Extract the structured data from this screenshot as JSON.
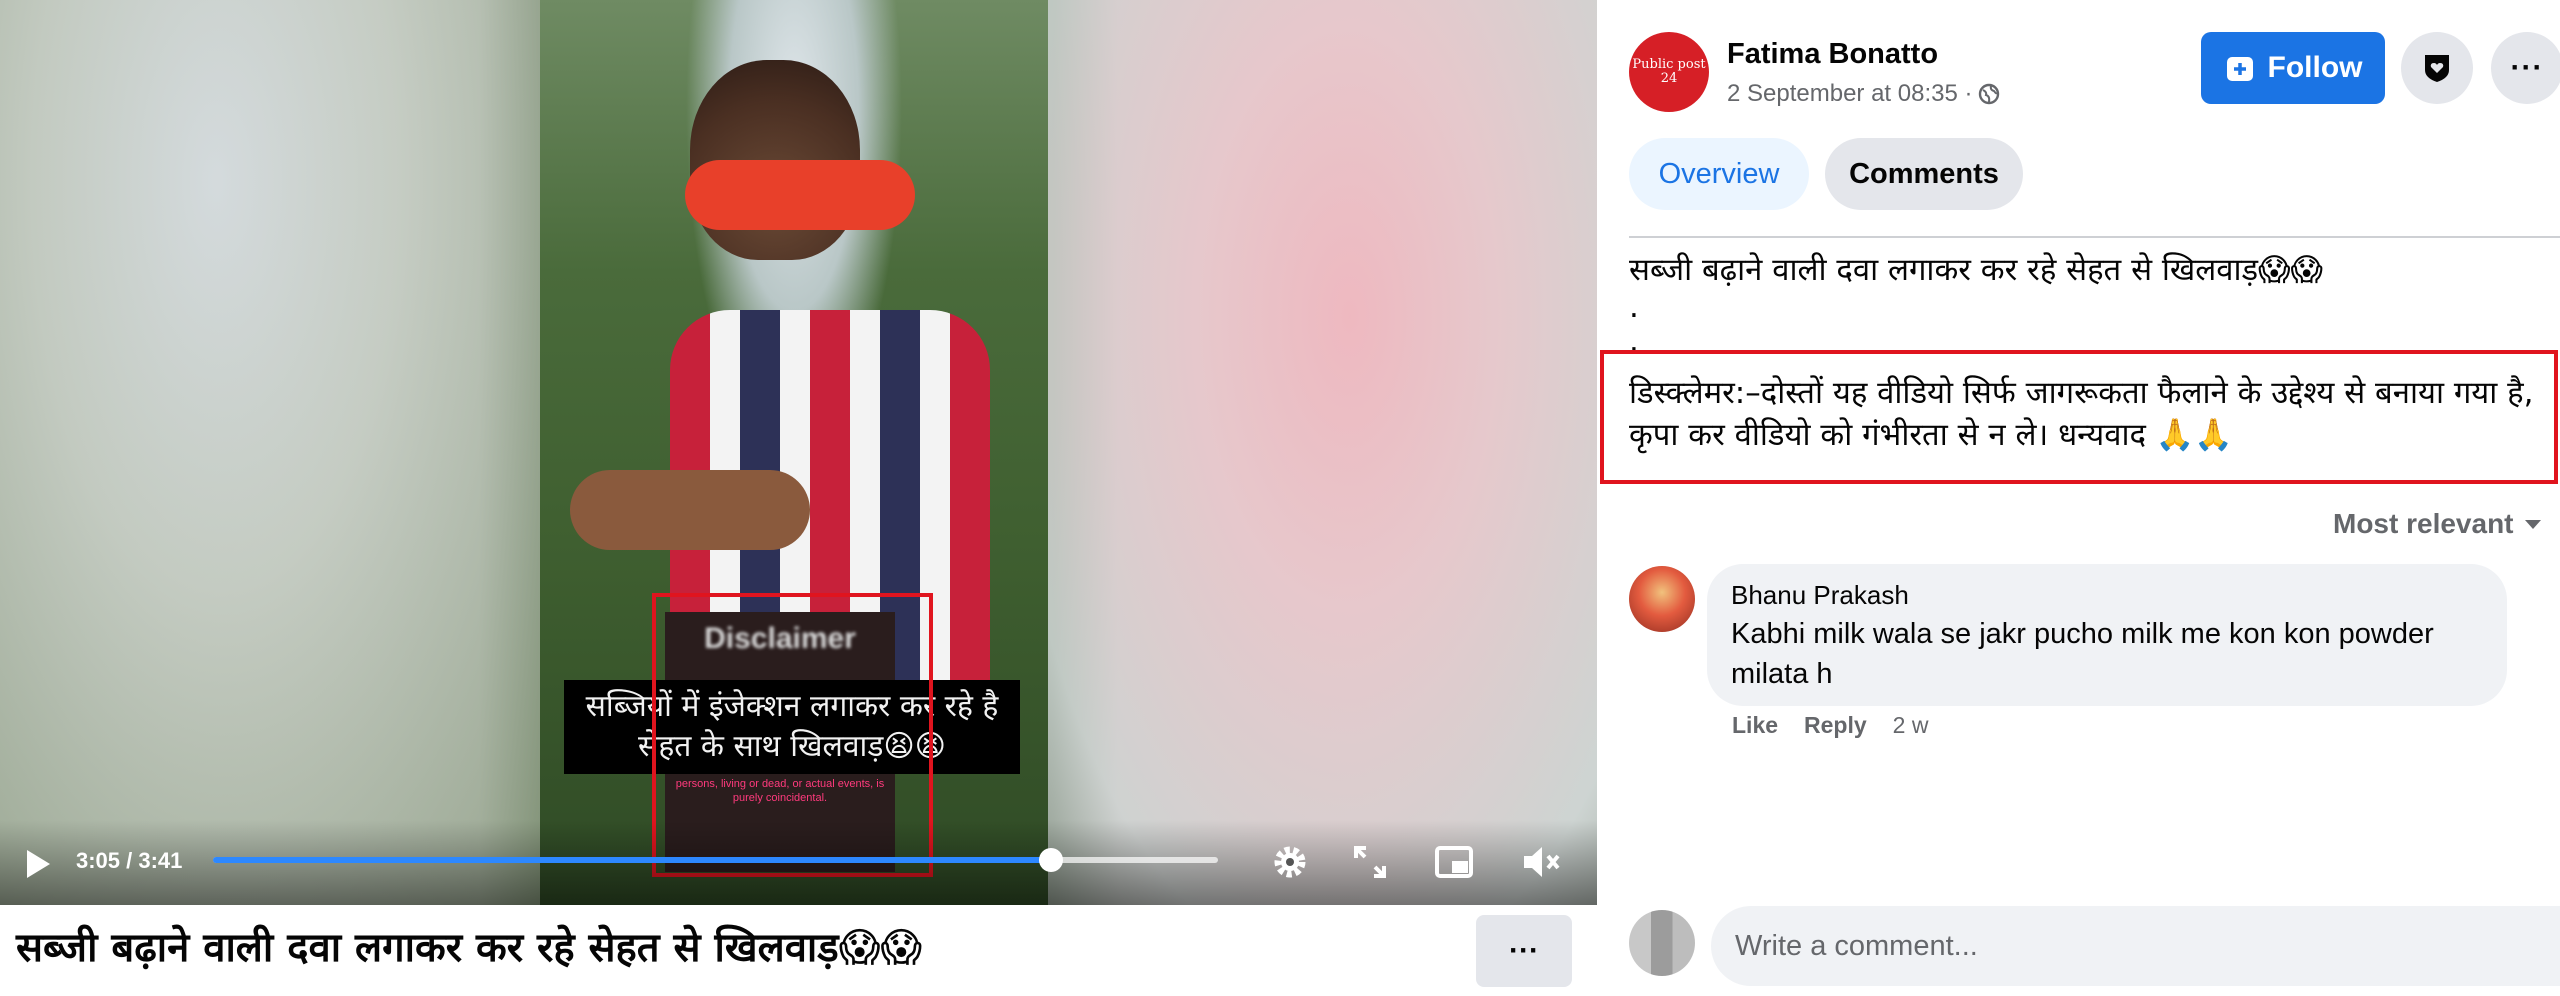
{
  "video": {
    "overlay_line1": "सब्जियों में इंजेक्शन लगाकर कर रहे है",
    "overlay_line2": "सेहत के साथ खिलवाड़😫😫",
    "disclaimer_title": "Disclaimer",
    "disclaimer_footer": "persons, living or dead, or actual events, is purely coincidental.",
    "time": "3:05 / 3:41",
    "progress_fraction": 0.834,
    "title": "सब्जी बढ़ाने वाली दवा लगाकर कर रहे सेहत से खिलवाड़😱😱",
    "more_label": "···"
  },
  "post": {
    "avatar_text_line1": "Public post",
    "avatar_text_line2": "24",
    "author": "Fatima Bonatto",
    "timestamp": "2 September at 08:35 ·",
    "follow_label": "Follow",
    "more_label": "···",
    "tabs": [
      {
        "label": "Overview"
      },
      {
        "label": "Comments"
      }
    ],
    "text_line1": "सब्जी बढ़ाने वाली दवा लगाकर कर रहे सेहत से खिलवाड़😱😱",
    "dot1": ".",
    "dot2": ".",
    "disclaimer_text": "डिस्क्लेमर:–दोस्तों यह वीडियो सिर्फ जागरूकता फैलाने के उद्देश्य से बनाया गया है, कृपा कर वीडियो को गंभीरता से न ले। धन्यवाद 🙏🙏"
  },
  "comments": {
    "sort_label": "Most relevant",
    "items": [
      {
        "name": "Bhanu Prakash",
        "text": "Kabhi milk wala se jakr pucho milk me kon kon powder milata h",
        "like": "Like",
        "reply": "Reply",
        "age": "2 w"
      }
    ],
    "input_placeholder": "Write a comment..."
  },
  "colors": {
    "accent": "#1b74e4",
    "highlight_box": "#e0141e",
    "progress": "#2d88ff"
  }
}
